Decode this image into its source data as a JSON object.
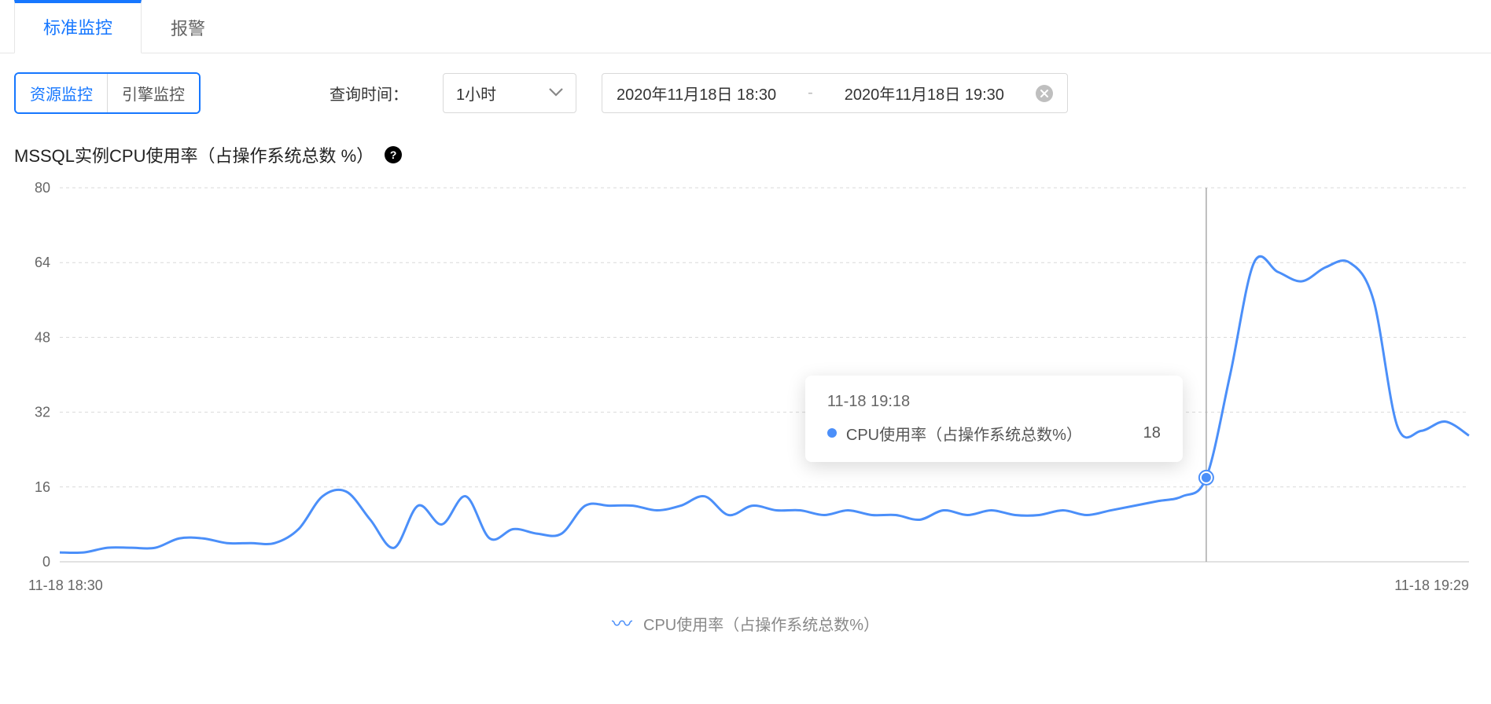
{
  "tabs": {
    "primary": {
      "standard": "标准监控",
      "alert": "报警"
    },
    "secondary": {
      "resource": "资源监控",
      "engine": "引擎监控"
    }
  },
  "query": {
    "label": "查询时间：",
    "range_preset": "1小时",
    "from": "2020年11月18日 18:30",
    "sep": "-",
    "to": "2020年11月18日 19:30"
  },
  "chart": {
    "title": "MSSQL实例CPU使用率（占操作系统总数 %）",
    "x_start": "11-18 18:30",
    "x_end": "11-18 19:29",
    "legend_label": "CPU使用率（占操作系统总数%）"
  },
  "tooltip": {
    "time": "11-18 19:18",
    "label": "CPU使用率（占操作系统总数%）",
    "value": "18"
  },
  "chart_data": {
    "type": "line",
    "title": "MSSQL实例CPU使用率（占操作系统总数 %）",
    "xlabel": "",
    "ylabel": "",
    "ylim": [
      0,
      80
    ],
    "yticks": [
      0,
      16,
      32,
      48,
      64,
      80
    ],
    "x_range": [
      "11-18 18:30",
      "11-18 19:29"
    ],
    "series": [
      {
        "name": "CPU使用率（占操作系统总数%）",
        "color": "#4b8ff9",
        "x": [
          0,
          1,
          2,
          3,
          4,
          5,
          6,
          7,
          8,
          9,
          10,
          11,
          12,
          13,
          14,
          15,
          16,
          17,
          18,
          19,
          20,
          21,
          22,
          23,
          24,
          25,
          26,
          27,
          28,
          29,
          30,
          31,
          32,
          33,
          34,
          35,
          36,
          37,
          38,
          39,
          40,
          41,
          42,
          43,
          44,
          45,
          46,
          47,
          48,
          49,
          50,
          51,
          52,
          53,
          54,
          55,
          56,
          57,
          58,
          59
        ],
        "values": [
          2,
          2,
          3,
          3,
          3,
          5,
          5,
          4,
          4,
          4,
          7,
          14,
          15,
          9,
          3,
          12,
          8,
          14,
          5,
          7,
          6,
          6,
          12,
          12,
          12,
          11,
          12,
          14,
          10,
          12,
          11,
          11,
          10,
          11,
          10,
          10,
          9,
          11,
          10,
          11,
          10,
          10,
          11,
          10,
          11,
          12,
          13,
          14,
          18,
          40,
          64,
          62,
          60,
          63,
          64,
          56,
          29,
          28,
          30,
          27
        ]
      }
    ],
    "hover": {
      "x_index": 48,
      "time_label": "11-18 19:18",
      "value": 18
    }
  }
}
